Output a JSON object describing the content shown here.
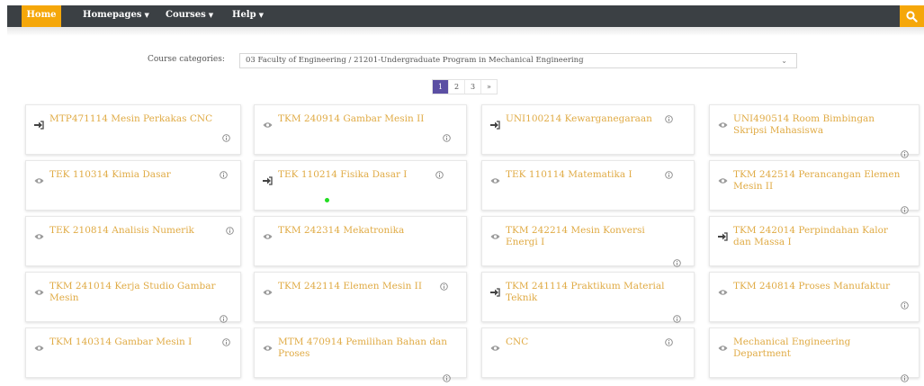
{
  "nav": {
    "home": "Home",
    "homepages": "Homepages",
    "courses": "Courses",
    "help": "Help",
    "search_icon": "search-icon"
  },
  "filter": {
    "label": "Course categories:",
    "selected": "03 Faculty of Engineering / 21201-Undergraduate Program in Mechanical Engineering"
  },
  "pagination": {
    "pages": [
      "1",
      "2",
      "3"
    ],
    "current": "1",
    "next": "»"
  },
  "courses": [
    {
      "title": "MTP471114 Mesin Perkakas CNC",
      "icon": "sign-in-icon"
    },
    {
      "title": "TKM 240914 Gambar Mesin II",
      "icon": "eye-icon"
    },
    {
      "title": "UNI100214 Kewarganegaraan",
      "icon": "sign-in-icon"
    },
    {
      "title": "UNI490514 Room Bimbingan Skripsi Mahasiswa",
      "icon": "eye-icon"
    },
    {
      "title": "TEK 110314 Kimia Dasar",
      "icon": "eye-icon"
    },
    {
      "title": "TEK 110214 Fisika Dasar I",
      "icon": "sign-in-icon"
    },
    {
      "title": "TEK 110114 Matematika I",
      "icon": "eye-icon"
    },
    {
      "title": "TKM 242514 Perancangan Elemen Mesin II",
      "icon": "eye-icon"
    },
    {
      "title": "TEK 210814 Analisis Numerik",
      "icon": "eye-icon"
    },
    {
      "title": "TKM 242314 Mekatronika",
      "icon": "eye-icon"
    },
    {
      "title": "TKM 242214 Mesin Konversi Energi I",
      "icon": "eye-icon"
    },
    {
      "title": "TKM 242014 Perpindahan Kalor dan Massa I",
      "icon": "sign-in-icon"
    },
    {
      "title": "TKM 241014 Kerja Studio Gambar Mesin",
      "icon": "eye-icon"
    },
    {
      "title": "TKM 242114 Elemen Mesin II",
      "icon": "eye-icon"
    },
    {
      "title": "TKM 241114 Praktikum Material Teknik",
      "icon": "sign-in-icon"
    },
    {
      "title": "TKM 240814 Proses Manufaktur",
      "icon": "eye-icon"
    },
    {
      "title": "TKM 140314 Gambar Mesin I",
      "icon": "eye-icon"
    },
    {
      "title": "MTM 470914 Pemilihan Bahan dan Proses",
      "icon": "eye-icon"
    },
    {
      "title": "CNC",
      "icon": "eye-icon"
    },
    {
      "title": "Mechanical Engineering Department",
      "icon": "eye-icon"
    }
  ],
  "colors": {
    "navbar": "#3b4044",
    "accent": "#f5a70a",
    "course_title": "#e0ab45",
    "page_active": "#5b4fa3"
  }
}
